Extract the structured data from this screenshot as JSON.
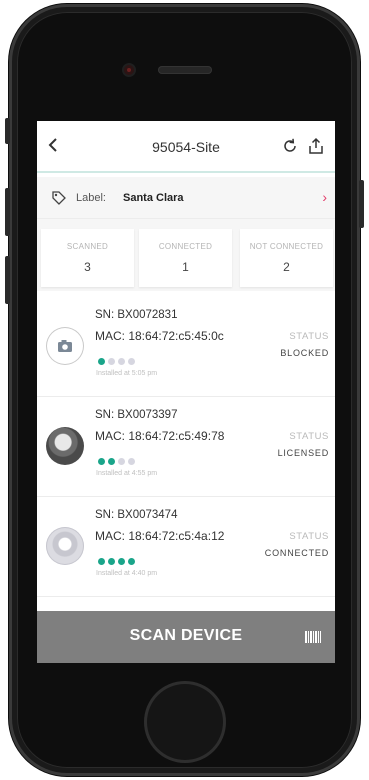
{
  "header": {
    "back_icon": "chevron-left-icon",
    "title": "95054-Site",
    "refresh_icon": "refresh-icon",
    "share_icon": "share-icon"
  },
  "label_row": {
    "icon": "tag-icon",
    "key": "Label:",
    "value": "Santa Clara",
    "chevron": "›"
  },
  "stats": [
    {
      "label": "SCANNED",
      "value": "3"
    },
    {
      "label": "CONNECTED",
      "value": "1"
    },
    {
      "label": "NOT CONNECTED",
      "value": "2"
    }
  ],
  "devices": [
    {
      "sn": "SN: BX0072831",
      "mac": "MAC: 18:64:72:c5:45:0c",
      "installed": "Installed at 5:05 pm",
      "status_label": "STATUS",
      "status": "BLOCKED",
      "signal_level": 1
    },
    {
      "sn": "SN: BX0073397",
      "mac": "MAC: 18:64:72:c5:49:78",
      "installed": "Installed at 4:55 pm",
      "status_label": "STATUS",
      "status": "LICENSED",
      "signal_level": 2
    },
    {
      "sn": "SN: BX0073474",
      "mac": "MAC: 18:64:72:c5:4a:12",
      "installed": "Installed at 4:40 pm",
      "status_label": "STATUS",
      "status": "CONNECTED",
      "signal_level": 4
    }
  ],
  "scan": {
    "label": "SCAN DEVICE",
    "icon": "barcode-icon"
  },
  "colors": {
    "accent": "#1aa58a",
    "dot_off": "#d6d6e0",
    "chevron": "#e23c6a",
    "scan_bar": "#7f7f7f"
  }
}
